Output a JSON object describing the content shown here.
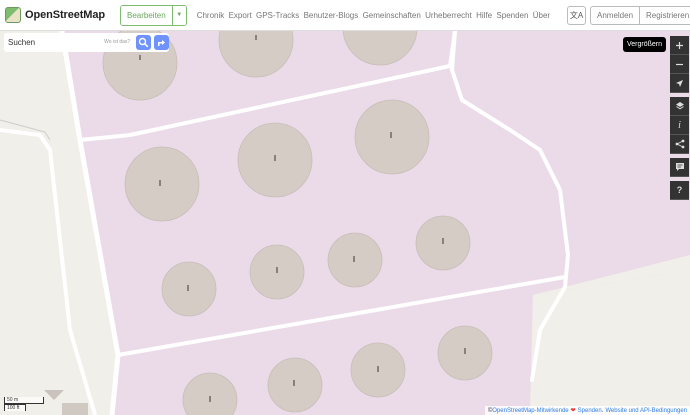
{
  "header": {
    "logo_text": "OpenStreetMap",
    "edit_label": "Bearbeiten",
    "nav": [
      "Chronik",
      "Export",
      "GPS-Tracks",
      "Benutzer-Blogs",
      "Gemeinschaften",
      "Urheberrecht",
      "Hilfe",
      "Spenden",
      "Über"
    ],
    "login_label": "Anmelden",
    "register_label": "Registrieren"
  },
  "search": {
    "placeholder": "Suchen",
    "hint": "Wo ist das?"
  },
  "map_controls": {
    "tooltip": "Vergrößern",
    "icons": [
      "zoom-in-icon",
      "zoom-out-icon",
      "locate-icon",
      "layers-icon",
      "info-icon",
      "share-icon",
      "note-icon",
      "query-icon"
    ]
  },
  "scale": {
    "metric": "50 m",
    "imperial": "100 ft"
  },
  "attribution": {
    "prefix": "© ",
    "contributors": "OpenStreetMap-Mitwirkende",
    "heart": "❤",
    "donate": "Spenden",
    "sep": ".",
    "terms": "Website und API-Bedingungen"
  },
  "colors": {
    "landuse": "#ebdbe8",
    "tree_canopy": "#d6ccc6",
    "road": "#ffffff",
    "gray_area": "#f1efe9",
    "accent": "#7ebc6f",
    "search_button": "#7092ff"
  }
}
